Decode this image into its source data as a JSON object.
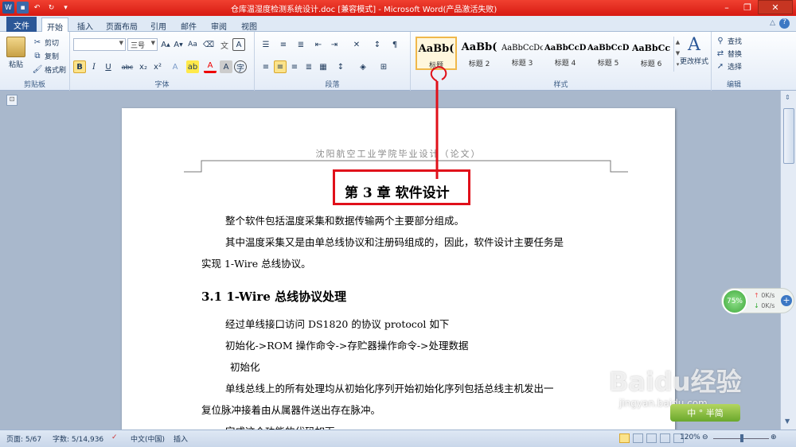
{
  "window": {
    "title": "仓库温湿度检测系统设计.doc [兼容模式] - Microsoft Word(产品激活失败)",
    "app_icon_letter": "W"
  },
  "tabs": [
    "文件",
    "开始",
    "插入",
    "页面布局",
    "引用",
    "邮件",
    "审阅",
    "视图"
  ],
  "ribbon": {
    "clipboard": {
      "paste": "粘贴",
      "cut": "剪切",
      "copy": "复制",
      "format_painter": "格式刷",
      "label": "剪贴板"
    },
    "font": {
      "font_name": "",
      "font_size": "三号",
      "bold": "B",
      "italic": "I",
      "underline": "U",
      "strike": "abc",
      "subscript": "x₂",
      "superscript": "x²",
      "label": "字体"
    },
    "paragraph": {
      "label": "段落"
    },
    "styles": {
      "label": "样式",
      "items": [
        {
          "sample": "AaBb(",
          "name": "标题"
        },
        {
          "sample": "AaBb(",
          "name": "标题 2"
        },
        {
          "sample": "AaBbCcDc",
          "name": "标题 3"
        },
        {
          "sample": "AaBbCcD",
          "name": "标题 4"
        },
        {
          "sample": "AaBbCcD",
          "name": "标题 5"
        },
        {
          "sample": "AaBbCc",
          "name": "标题 6"
        }
      ],
      "change_styles": "更改样式"
    },
    "editing": {
      "find": "查找",
      "replace": "替换",
      "select": "选择",
      "label": "编辑"
    }
  },
  "document": {
    "header": "沈阳航空工业学院毕业设计（论文）",
    "chapter_title": "第 3 章  软件设计",
    "paragraphs": [
      "整个软件包括温度采集和数据传输两个主要部分组成。",
      "其中温度采集又是由单总线协议和注册码组成的，因此，软件设计主要任务是",
      "实现 1-Wire 总线协议。"
    ],
    "section_heading": "3.1 1-Wire 总线协议处理",
    "section_paragraphs": [
      "经过单线接口访问 DS1820  的协议 protocol  如下",
      "初始化->ROM 操作命令->存贮器操作命令->处理数据",
      "初始化",
      "单线总线上的所有处理均从初始化序列开始初始化序列包括总线主机发出一",
      "复位脉冲接着由从属器件送出存在脉冲。",
      "完成这个功能的代码如下"
    ]
  },
  "statusbar": {
    "page": "页面: 5/67",
    "words": "字数: 5/14,936",
    "language": "中文(中国)",
    "mode": "插入",
    "zoom": "120%"
  },
  "net_widget": {
    "percent": "75%",
    "upload": "0K/s",
    "download": "0K/s"
  },
  "watermark": {
    "brand": "Baidu经验",
    "url": "jingyan.baidu.com",
    "badge": "中 ° 半简"
  },
  "annotation_color": "#e0101a"
}
